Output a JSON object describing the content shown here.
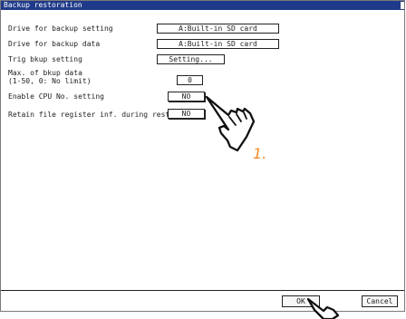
{
  "window": {
    "title": "Backup restoration"
  },
  "settings": [
    {
      "label": "Drive for backup setting",
      "value": "A:Built-in SD card"
    },
    {
      "label": "Drive for backup data",
      "value": "A:Built-in SD card"
    },
    {
      "label": "Trig bkup setting",
      "value": "Setting..."
    },
    {
      "label": "Max. of bkup data\n(1-50, 0: No limit)",
      "value": "0"
    },
    {
      "label": "Enable CPU No. setting",
      "value": "NO"
    },
    {
      "label": "Retain file register inf. during restor",
      "value": "NO"
    }
  ],
  "buttons": {
    "ok": "OK",
    "cancel": "Cancel"
  },
  "annotation": {
    "step": "1."
  },
  "colors": {
    "titlebar": "#1f3a8a",
    "annotation": "#f28c28"
  },
  "icons": [
    "pointing-hand-icon"
  ]
}
